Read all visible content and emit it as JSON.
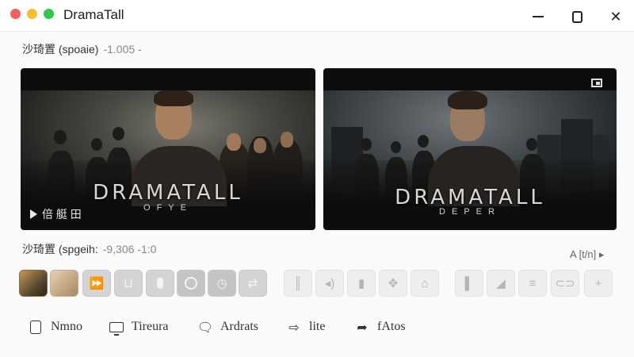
{
  "window": {
    "title": "DramaTall",
    "controls": {
      "minimize_icon": "minimize-icon",
      "maximize_icon": "maximize-icon",
      "close_glyph": "✕"
    },
    "traffic_colors": {
      "close": "#f45f57",
      "minimize": "#f7be2e",
      "zoom": "#2ec84a"
    }
  },
  "section_top": {
    "label": "沙琦置 (spoaie)",
    "value": "-1.005 -"
  },
  "panels": [
    {
      "title": "DRAMATALL",
      "subtitle": "OFYE",
      "play_label": "倍 艇 田",
      "play_icon": "play-icon"
    },
    {
      "title": "DRAMATALL",
      "subtitle": "DEPER",
      "corner_icon": "picture-in-picture-icon"
    }
  ],
  "section_mid": {
    "label": "沙琦置 (spgeih:",
    "value": "-9,306 -1:0",
    "right_label": "A [t/n] ▸"
  },
  "toolbar": {
    "buttons": [
      {
        "icon": "thumbnail-1-icon",
        "glyph": ""
      },
      {
        "icon": "thumbnail-2-icon",
        "glyph": ""
      },
      {
        "icon": "fast-forward-icon",
        "glyph": "⏩"
      },
      {
        "icon": "tray-icon",
        "glyph": "⊔"
      },
      {
        "icon": "pause-icon",
        "glyph": ""
      },
      {
        "icon": "record-icon",
        "glyph": ""
      },
      {
        "icon": "timer-icon",
        "glyph": "◷"
      },
      {
        "icon": "swap-icon",
        "glyph": "⇄"
      },
      {
        "icon": "levels-icon",
        "glyph": "║"
      },
      {
        "icon": "volume-icon",
        "glyph": "◂)"
      },
      {
        "icon": "book-icon",
        "glyph": "▮"
      },
      {
        "icon": "puzzle-icon",
        "glyph": "✥"
      },
      {
        "icon": "plug-icon",
        "glyph": "⌂"
      },
      {
        "icon": "brush-icon",
        "glyph": "▌"
      },
      {
        "icon": "ramp-icon",
        "glyph": "◢"
      },
      {
        "icon": "align-icon",
        "glyph": "≡"
      },
      {
        "icon": "link-icon",
        "glyph": "⊂⊃"
      },
      {
        "icon": "add-icon",
        "glyph": "+"
      }
    ]
  },
  "actions": [
    {
      "label": "Nmno",
      "icon": "note-icon"
    },
    {
      "label": "Tireura",
      "icon": "monitor-icon"
    },
    {
      "label": "Ardrats",
      "icon": "comment-icon",
      "glyph": "🗨"
    },
    {
      "label": "lite",
      "icon": "send-icon",
      "glyph": "⇨"
    },
    {
      "label": "fAtos",
      "icon": "share-icon",
      "glyph": "➦"
    }
  ]
}
